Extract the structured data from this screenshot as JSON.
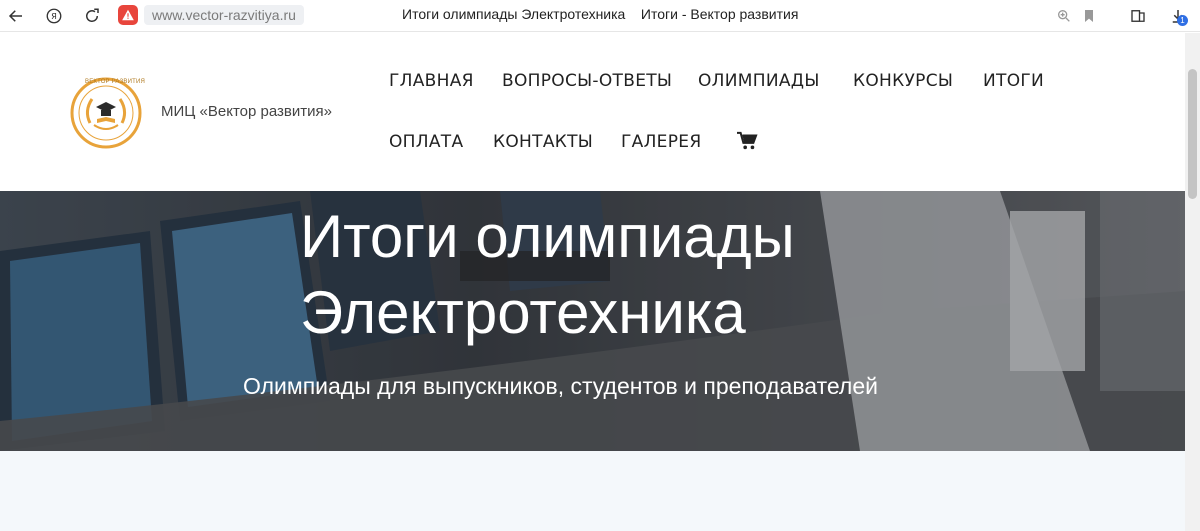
{
  "browser": {
    "url": "www.vector-razvitiya.ru",
    "tab_title": "Итоги олимпиады Электротехника    Итоги - Вектор развития",
    "download_count": "1",
    "icons": [
      "back-arrow-icon",
      "yandex-icon",
      "reload-icon",
      "warning-icon",
      "zoom-icon",
      "bookmark-icon",
      "collections-icon",
      "download-icon"
    ]
  },
  "header": {
    "brand_name": "МИЦ «Вектор развития»",
    "logo_text": "ВЕКТОР РАЗВИТИЯ",
    "menu": [
      {
        "label": "Главная"
      },
      {
        "label": "Вопросы-ответы"
      },
      {
        "label": "Олимпиады"
      },
      {
        "label": "Конкурсы"
      },
      {
        "label": "Итоги"
      },
      {
        "label": "Оплата"
      },
      {
        "label": "Контакты"
      },
      {
        "label": "Галерея"
      }
    ],
    "cart_icon": "cart-icon"
  },
  "hero": {
    "title": "Итоги олимпиады Электротехника",
    "subtitle": "Олимпиады для выпускников, студентов и преподавателей"
  },
  "colors": {
    "logo_orange": "#e8a33a",
    "warning_red": "#e8453c",
    "content_bg": "#f4f8fb"
  }
}
